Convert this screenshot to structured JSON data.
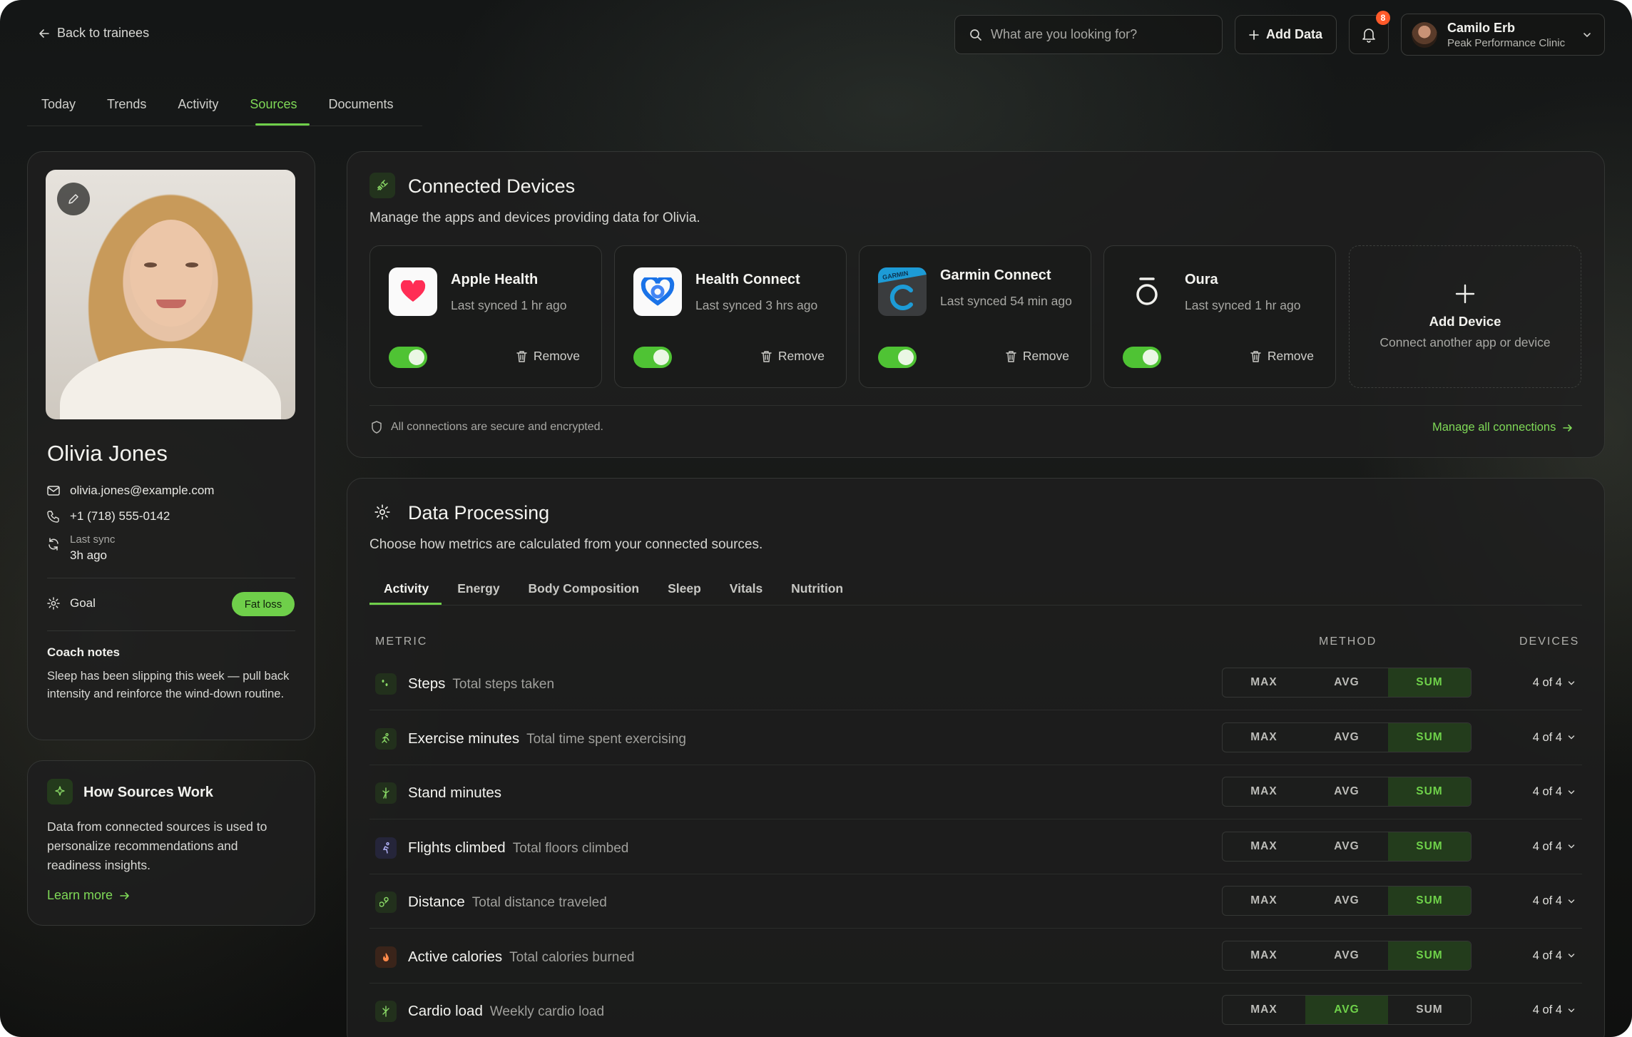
{
  "nav": {
    "back_label": "Back to trainees"
  },
  "search": {
    "placeholder": "What are you looking for?"
  },
  "header": {
    "add_data_label": "Add Data",
    "notification_count": "8",
    "user_name": "Camilo Erb",
    "user_clinic": "Peak Performance Clinic"
  },
  "tabs": [
    {
      "label": "Today"
    },
    {
      "label": "Trends"
    },
    {
      "label": "Activity"
    },
    {
      "label": "Sources",
      "active": true
    },
    {
      "label": "Documents"
    }
  ],
  "profile": {
    "name": "Olivia Jones",
    "email": "olivia.jones@example.com",
    "phone": "+1 (718) 555-0142",
    "last_sync_label": "Last sync",
    "last_sync_value": "3h ago",
    "goal_label": "Goal",
    "goal_value": "Fat loss",
    "coach_notes_title": "Coach notes",
    "coach_notes_body": "Sleep has been slipping this week — pull back intensity and reinforce the wind-down routine."
  },
  "how_sources": {
    "title": "How Sources Work",
    "body": "Data from connected sources is used to personalize recommendations and readiness insights.",
    "link": "Learn more"
  },
  "connected_devices": {
    "title": "Connected Devices",
    "subtitle": "Manage the apps and devices providing data for Olivia.",
    "remove_label": "Remove",
    "devices": [
      {
        "name": "Apple Health",
        "sync": "Last synced 1 hr ago",
        "enabled": true
      },
      {
        "name": "Health Connect",
        "sync": "Last synced 3 hrs ago",
        "enabled": true
      },
      {
        "name": "Garmin Connect",
        "sync": "Last synced 54 min ago",
        "enabled": true,
        "logo_text": "GARMIN"
      },
      {
        "name": "Oura",
        "sync": "Last synced 1 hr ago",
        "enabled": true
      }
    ],
    "add_device_title": "Add Device",
    "add_device_sub": "Connect another app or device",
    "secure_note": "All connections are secure and encrypted.",
    "manage_link": "Manage all connections"
  },
  "data_processing": {
    "title": "Data Processing",
    "subtitle": "Choose how metrics are calculated from your connected sources.",
    "tabs": [
      "Activity",
      "Energy",
      "Body Composition",
      "Sleep",
      "Vitals",
      "Nutrition"
    ],
    "columns": {
      "metric": "METRIC",
      "method": "METHOD",
      "devices": "DEVICES"
    },
    "methods": [
      "MAX",
      "AVG",
      "SUM"
    ],
    "rows": [
      {
        "name": "Steps",
        "desc": "Total steps taken",
        "method": "SUM",
        "devices": "4 of 4"
      },
      {
        "name": "Exercise minutes",
        "desc": "Total time spent exercising",
        "method": "SUM",
        "devices": "4 of 4"
      },
      {
        "name": "Stand minutes",
        "desc": "",
        "method": "SUM",
        "devices": "4 of 4"
      },
      {
        "name": "Flights climbed",
        "desc": "Total floors climbed",
        "method": "SUM",
        "devices": "4 of 4"
      },
      {
        "name": "Distance",
        "desc": "Total distance traveled",
        "method": "SUM",
        "devices": "4 of 4"
      },
      {
        "name": "Active calories",
        "desc": "Total calories burned",
        "method": "SUM",
        "devices": "4 of 4"
      },
      {
        "name": "Cardio load",
        "desc": "Weekly cardio load",
        "method": "AVG",
        "devices": "4 of 4"
      }
    ]
  },
  "colors": {
    "accent": "#6fcf4a",
    "badge": "#ff5a2a",
    "background": "#161716"
  }
}
